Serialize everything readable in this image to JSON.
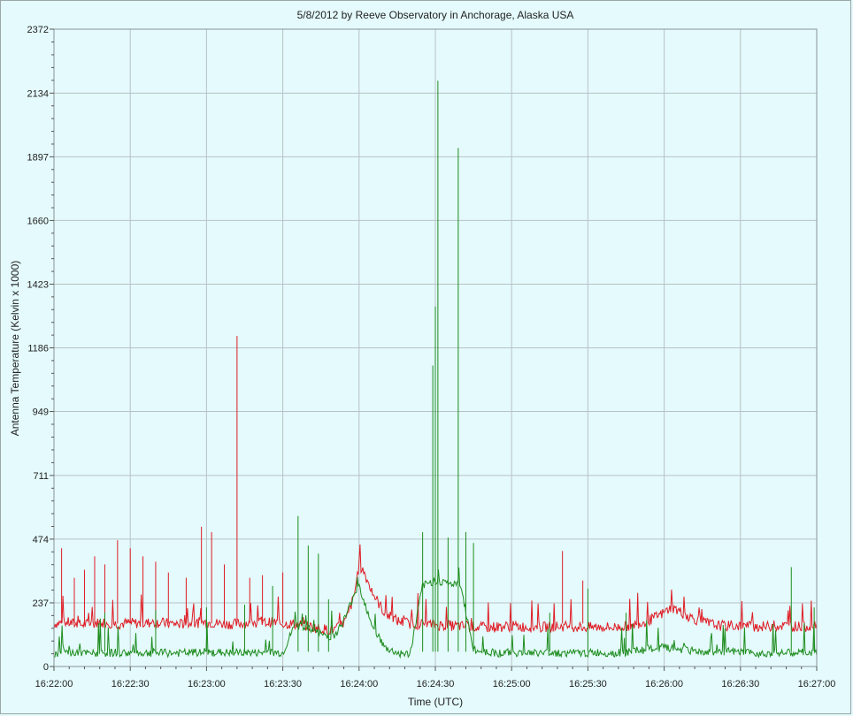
{
  "chart_data": {
    "type": "line",
    "title": "5/8/2012  by  Reeve Observatory  in  Anchorage, Alaska  USA",
    "xlabel": "Time (UTC)",
    "ylabel": "Antenna Temperature (Kelvin x 1000)",
    "ylim": [
      0,
      2372
    ],
    "y_ticks": [
      0,
      237,
      474,
      711,
      949,
      1186,
      1423,
      1660,
      1897,
      2134,
      2372
    ],
    "x_ticks": [
      "16:22:00",
      "16:22:30",
      "16:23:00",
      "16:23:30",
      "16:24:00",
      "16:24:30",
      "16:25:00",
      "16:25:30",
      "16:26:00",
      "16:26:30",
      "16:27:00"
    ],
    "xlim_seconds": [
      0,
      300
    ],
    "grid": true,
    "series": [
      {
        "color": "#e01b24",
        "x": [
          0,
          5,
          10,
          15,
          20,
          25,
          30,
          35,
          40,
          45,
          50,
          55,
          60,
          65,
          70,
          75,
          80,
          85,
          90,
          95,
          100,
          105,
          110,
          112,
          115,
          118,
          120,
          122,
          125,
          128,
          130,
          135,
          140,
          145,
          150,
          155,
          160,
          165,
          170,
          175,
          180,
          185,
          190,
          195,
          200,
          205,
          210,
          215,
          220,
          225,
          230,
          235,
          240,
          243,
          245,
          250,
          255,
          260,
          265,
          270,
          275,
          280,
          285,
          290,
          295,
          300
        ],
        "values": [
          160,
          165,
          155,
          160,
          165,
          158,
          162,
          160,
          165,
          160,
          158,
          162,
          165,
          160,
          158,
          162,
          160,
          165,
          160,
          158,
          150,
          140,
          135,
          145,
          175,
          260,
          380,
          350,
          280,
          230,
          200,
          170,
          160,
          158,
          155,
          152,
          150,
          148,
          145,
          148,
          150,
          148,
          145,
          148,
          150,
          148,
          145,
          148,
          145,
          150,
          160,
          175,
          200,
          220,
          210,
          185,
          165,
          155,
          150,
          152,
          150,
          148,
          152,
          150,
          148,
          155
        ],
        "spikes": [
          {
            "x": 3,
            "value": 440
          },
          {
            "x": 8,
            "value": 330
          },
          {
            "x": 12,
            "value": 360
          },
          {
            "x": 16,
            "value": 410
          },
          {
            "x": 20,
            "value": 380
          },
          {
            "x": 25,
            "value": 470
          },
          {
            "x": 30,
            "value": 440
          },
          {
            "x": 35,
            "value": 410
          },
          {
            "x": 40,
            "value": 390
          },
          {
            "x": 45,
            "value": 350
          },
          {
            "x": 52,
            "value": 330
          },
          {
            "x": 58,
            "value": 520
          },
          {
            "x": 62,
            "value": 500
          },
          {
            "x": 67,
            "value": 380
          },
          {
            "x": 72,
            "value": 1230
          },
          {
            "x": 77,
            "value": 330
          },
          {
            "x": 82,
            "value": 340
          },
          {
            "x": 90,
            "value": 350
          },
          {
            "x": 200,
            "value": 430
          },
          {
            "x": 208,
            "value": 320
          }
        ]
      },
      {
        "color": "#1e8c1e",
        "x": [
          0,
          5,
          10,
          15,
          20,
          25,
          30,
          35,
          40,
          45,
          50,
          55,
          60,
          65,
          70,
          75,
          80,
          85,
          90,
          95,
          100,
          105,
          110,
          112,
          115,
          118,
          120,
          125,
          130,
          135,
          140,
          145,
          150,
          155,
          160,
          165,
          170,
          175,
          180,
          185,
          190,
          195,
          200,
          205,
          210,
          215,
          220,
          225,
          230,
          235,
          240,
          245,
          250,
          255,
          260,
          265,
          270,
          275,
          280,
          285,
          290,
          295,
          300
        ],
        "values": [
          50,
          52,
          50,
          48,
          50,
          52,
          50,
          50,
          52,
          50,
          50,
          52,
          50,
          52,
          50,
          52,
          50,
          52,
          50,
          160,
          140,
          120,
          110,
          140,
          190,
          270,
          300,
          160,
          70,
          50,
          45,
          300,
          320,
          310,
          300,
          60,
          55,
          50,
          52,
          50,
          50,
          52,
          50,
          48,
          50,
          52,
          50,
          52,
          60,
          65,
          70,
          65,
          60,
          55,
          50,
          55,
          52,
          50,
          50,
          52,
          50,
          52,
          50
        ],
        "spikes": [
          {
            "x": 20,
            "value": 200
          },
          {
            "x": 40,
            "value": 210
          },
          {
            "x": 60,
            "value": 220
          },
          {
            "x": 75,
            "value": 230
          },
          {
            "x": 86,
            "value": 300
          },
          {
            "x": 96,
            "value": 560
          },
          {
            "x": 100,
            "value": 450
          },
          {
            "x": 104,
            "value": 420
          },
          {
            "x": 108,
            "value": 250
          },
          {
            "x": 145,
            "value": 500
          },
          {
            "x": 149,
            "value": 1120
          },
          {
            "x": 150,
            "value": 1340
          },
          {
            "x": 151,
            "value": 2180
          },
          {
            "x": 155,
            "value": 480
          },
          {
            "x": 159,
            "value": 1930
          },
          {
            "x": 162,
            "value": 500
          },
          {
            "x": 165,
            "value": 460
          },
          {
            "x": 195,
            "value": 200
          },
          {
            "x": 210,
            "value": 290
          },
          {
            "x": 225,
            "value": 200
          },
          {
            "x": 290,
            "value": 370
          },
          {
            "x": 299,
            "value": 220
          }
        ]
      }
    ]
  }
}
